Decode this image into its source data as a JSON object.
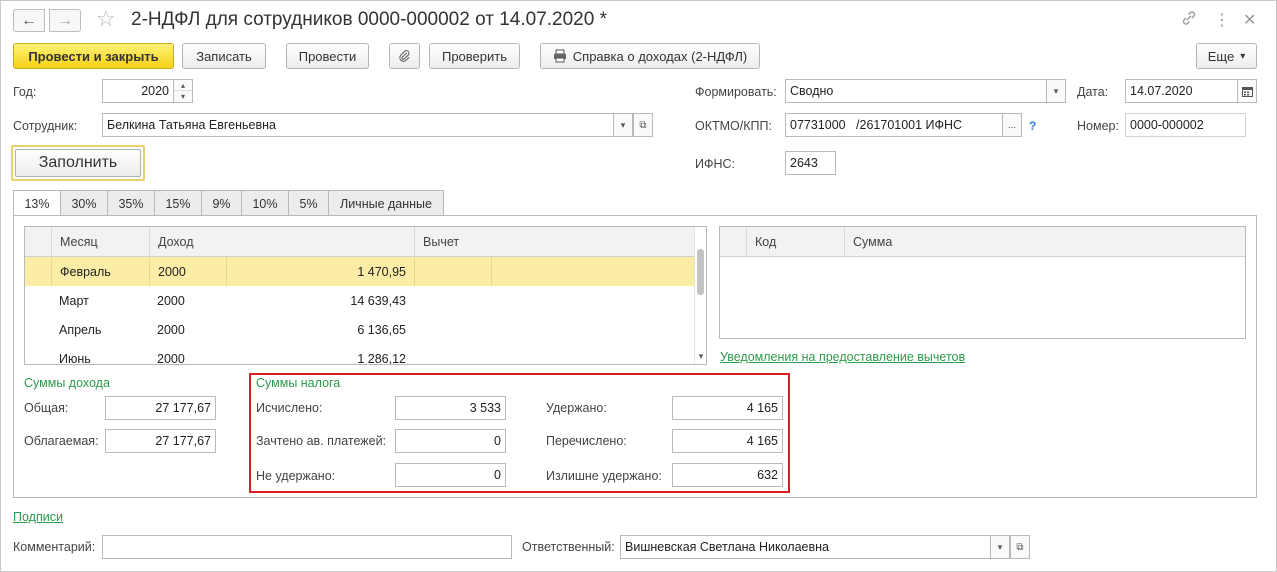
{
  "window": {
    "title": "2-НДФЛ для сотрудников 0000-000002 от 14.07.2020 *",
    "back_icon": "←",
    "forward_icon": "→",
    "star_icon": "☆",
    "link_icon": "🔗",
    "more_icon": "⋮",
    "close_icon": "✕"
  },
  "toolbar": {
    "post_close": "Провести и закрыть",
    "save": "Записать",
    "post": "Провести",
    "attach_icon": "📎",
    "check": "Проверить",
    "print_icon": "🖶",
    "income_cert": "Справка о доходах (2-НДФЛ)",
    "more": "Еще",
    "more_arrow": "▾"
  },
  "form": {
    "year_label": "Год:",
    "year_value": "2020",
    "employee_label": "Сотрудник:",
    "employee_value": "Белкина Татьяна Евгеньевна",
    "fill_button": "Заполнить",
    "form_label": "Формировать:",
    "form_value": "Сводно",
    "date_label": "Дата:",
    "date_value": "14.07.2020",
    "oktmo_label": "ОКТМО/КПП:",
    "oktmo_value": "07731000   /261701001 ИФНС",
    "dots": "...",
    "question": "?",
    "number_label": "Номер:",
    "number_value": "0000-000002",
    "ifns_label": "ИФНС:",
    "ifns_value": "2643",
    "dd_arrow": "▾",
    "open_icon": "⧉",
    "calendar_icon": "▦",
    "spin_up": "▴",
    "spin_down": "▾"
  },
  "tabs": [
    "13%",
    "30%",
    "35%",
    "15%",
    "9%",
    "10%",
    "5%",
    "Личные данные"
  ],
  "income_grid": {
    "headers": {
      "month": "Месяц",
      "income": "Доход",
      "deduction": "Вычет"
    },
    "rows": [
      {
        "month": "Февраль",
        "code": "2000",
        "amount": "1 470,95"
      },
      {
        "month": "Март",
        "code": "2000",
        "amount": "14 639,43"
      },
      {
        "month": "Апрель",
        "code": "2000",
        "amount": "6 136,65"
      },
      {
        "month": "Июнь",
        "code": "2000",
        "amount": "1 286,12"
      }
    ],
    "scroll_down": "▾"
  },
  "deduction_grid": {
    "headers": {
      "code": "Код",
      "sum": "Сумма"
    },
    "link": "Уведомления на предоставление вычетов"
  },
  "income_sums": {
    "title": "Суммы дохода",
    "total_label": "Общая:",
    "total_value": "27 177,67",
    "taxable_label": "Облагаемая:",
    "taxable_value": "27 177,67"
  },
  "tax_sums": {
    "title": "Суммы налога",
    "calculated_label": "Исчислено:",
    "calculated_value": "3 533",
    "advance_label": "Зачтено ав. платежей:",
    "advance_value": "0",
    "not_withheld_label": "Не удержано:",
    "not_withheld_value": "0",
    "withheld_label": "Удержано:",
    "withheld_value": "4 165",
    "transferred_label": "Перечислено:",
    "transferred_value": "4 165",
    "over_withheld_label": "Излишне удержано:",
    "over_withheld_value": "632"
  },
  "footer": {
    "signatures_link": "Подписи",
    "comment_label": "Комментарий:",
    "comment_value": "",
    "responsible_label": "Ответственный:",
    "responsible_value": "Вишневская Светлана Николаевна"
  }
}
